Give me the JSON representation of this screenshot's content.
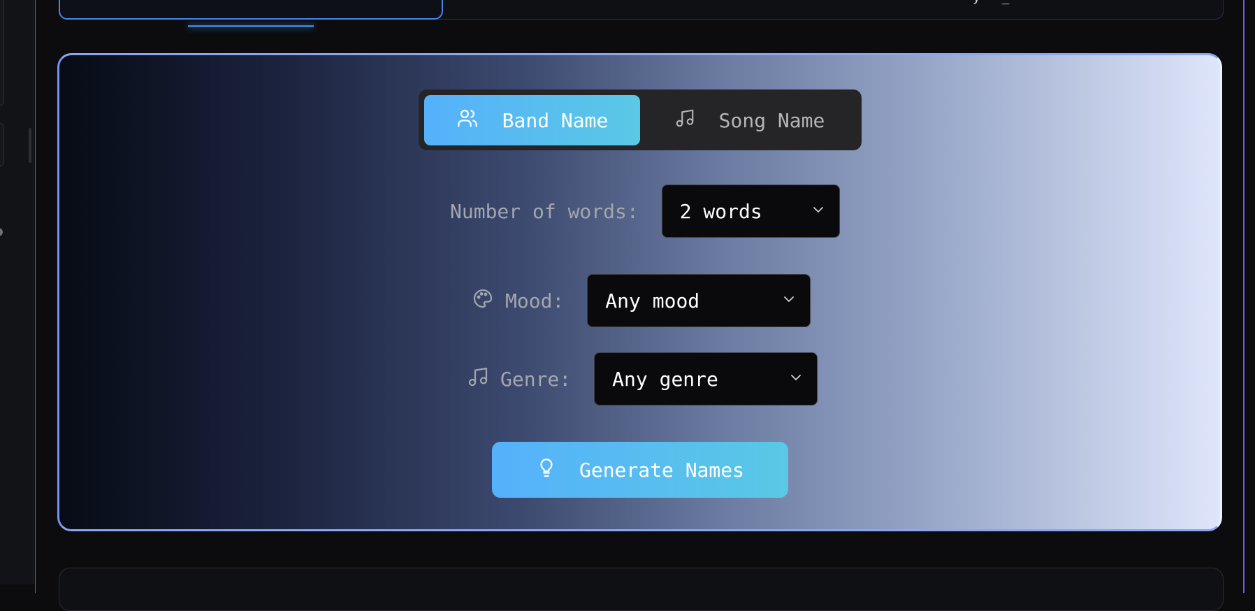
{
  "top": {
    "right_text": "y _"
  },
  "generator": {
    "mode_tabs": [
      {
        "label": "Band Name",
        "icon": "users-icon",
        "active": true
      },
      {
        "label": "Song Name",
        "icon": "music-note-icon",
        "active": false
      }
    ],
    "word_count": {
      "label": "Number of words:",
      "value": "2 words"
    },
    "mood": {
      "label": "Mood:",
      "icon": "palette-icon",
      "value": "Any mood"
    },
    "genre": {
      "label": "Genre:",
      "icon": "music-note-icon",
      "value": "Any genre"
    },
    "generate_button": {
      "label": "Generate Names",
      "icon": "lightbulb-icon"
    }
  },
  "colors": {
    "accent_gradient_start": "#55b1fb",
    "accent_gradient_end": "#5ac8e5",
    "card_border": "#6f95ee",
    "background": "#0c0c0f"
  }
}
